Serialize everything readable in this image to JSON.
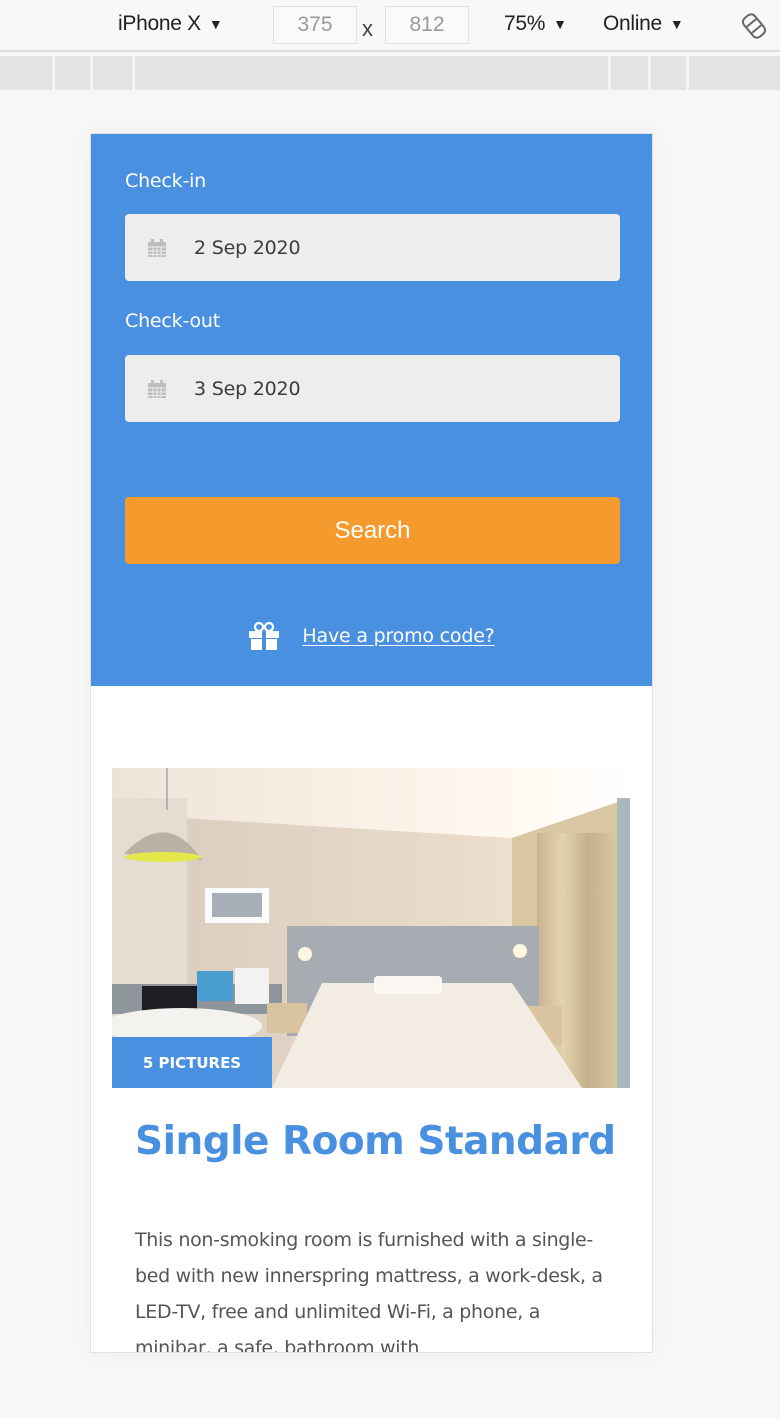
{
  "devtools": {
    "device": "iPhone X",
    "width": "375",
    "height": "812",
    "times": "x",
    "zoom": "75%",
    "network": "Online",
    "caret": "▼"
  },
  "booking": {
    "checkin_label": "Check-in",
    "checkin_value": "2 Sep 2020",
    "checkout_label": "Check-out",
    "checkout_value": "3 Sep 2020",
    "search_label": "Search",
    "promo_label": "Have a promo code?"
  },
  "room": {
    "pictures_badge": "5 PICTURES",
    "title": "Single Room Standard",
    "description": "This non-smoking room is furnished with a single-bed with new innerspring mattress, a work-desk, a LED-TV, free and unlimited Wi-Fi, a phone, a minibar, a safe, bathroom with"
  },
  "colors": {
    "primary": "#4a90e0",
    "accent": "#f59a2c",
    "field_bg": "#ededed"
  }
}
